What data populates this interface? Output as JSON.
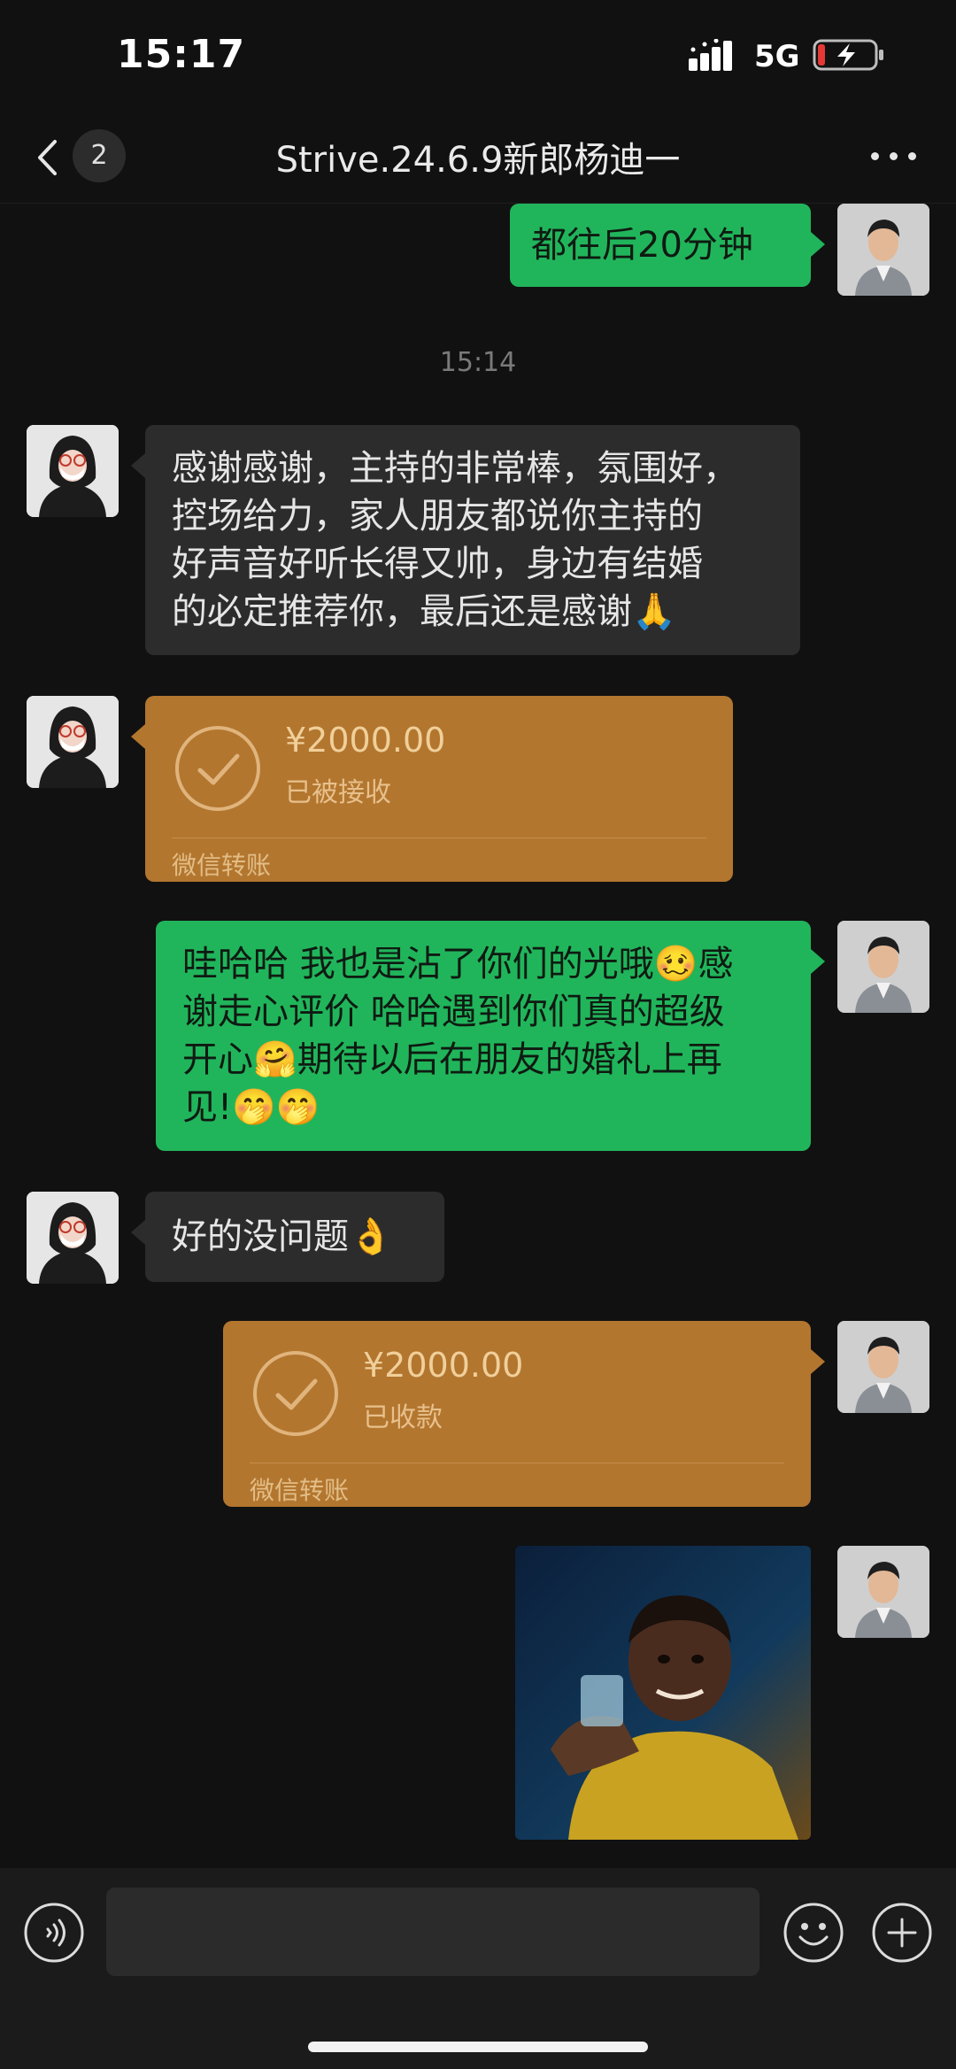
{
  "status_bar": {
    "time": "15:17",
    "network": "5G"
  },
  "nav": {
    "unread_count": "2",
    "title": "Strive.24.6.9新郎杨迪一"
  },
  "messages": {
    "m1": "都往后20分钟",
    "timestamp": "15:14",
    "m2_lines": [
      "感谢感谢，主持的非常棒，氛围好，",
      "控场给力，家人朋友都说你主持的",
      "好声音好听长得又帅，身边有结婚",
      "的必定推荐你，最后还是感谢🙏"
    ],
    "t1": {
      "amount": "¥2000.00",
      "status": "已被接收",
      "footer": "微信转账"
    },
    "m3_lines": [
      "哇哈哈 我也是沾了你们的光哦🥴感",
      "谢走心评价 哈哈遇到你们真的超级",
      "开心🤗期待以后在朋友的婚礼上再",
      "见!🤭🤭"
    ],
    "m4": "好的没问题👌",
    "t2": {
      "amount": "¥2000.00",
      "status": "已收款",
      "footer": "微信转账"
    }
  },
  "colors": {
    "background": "#111111",
    "bubble_green": "#21b55b",
    "bubble_gray": "#2c2c2c",
    "transfer_orange": "#b2762f"
  },
  "icons": {
    "back": "chevron-left-icon",
    "more": "more-dots-icon",
    "voice": "voice-icon",
    "emoji": "smile-icon",
    "plus": "plus-circle-icon"
  }
}
